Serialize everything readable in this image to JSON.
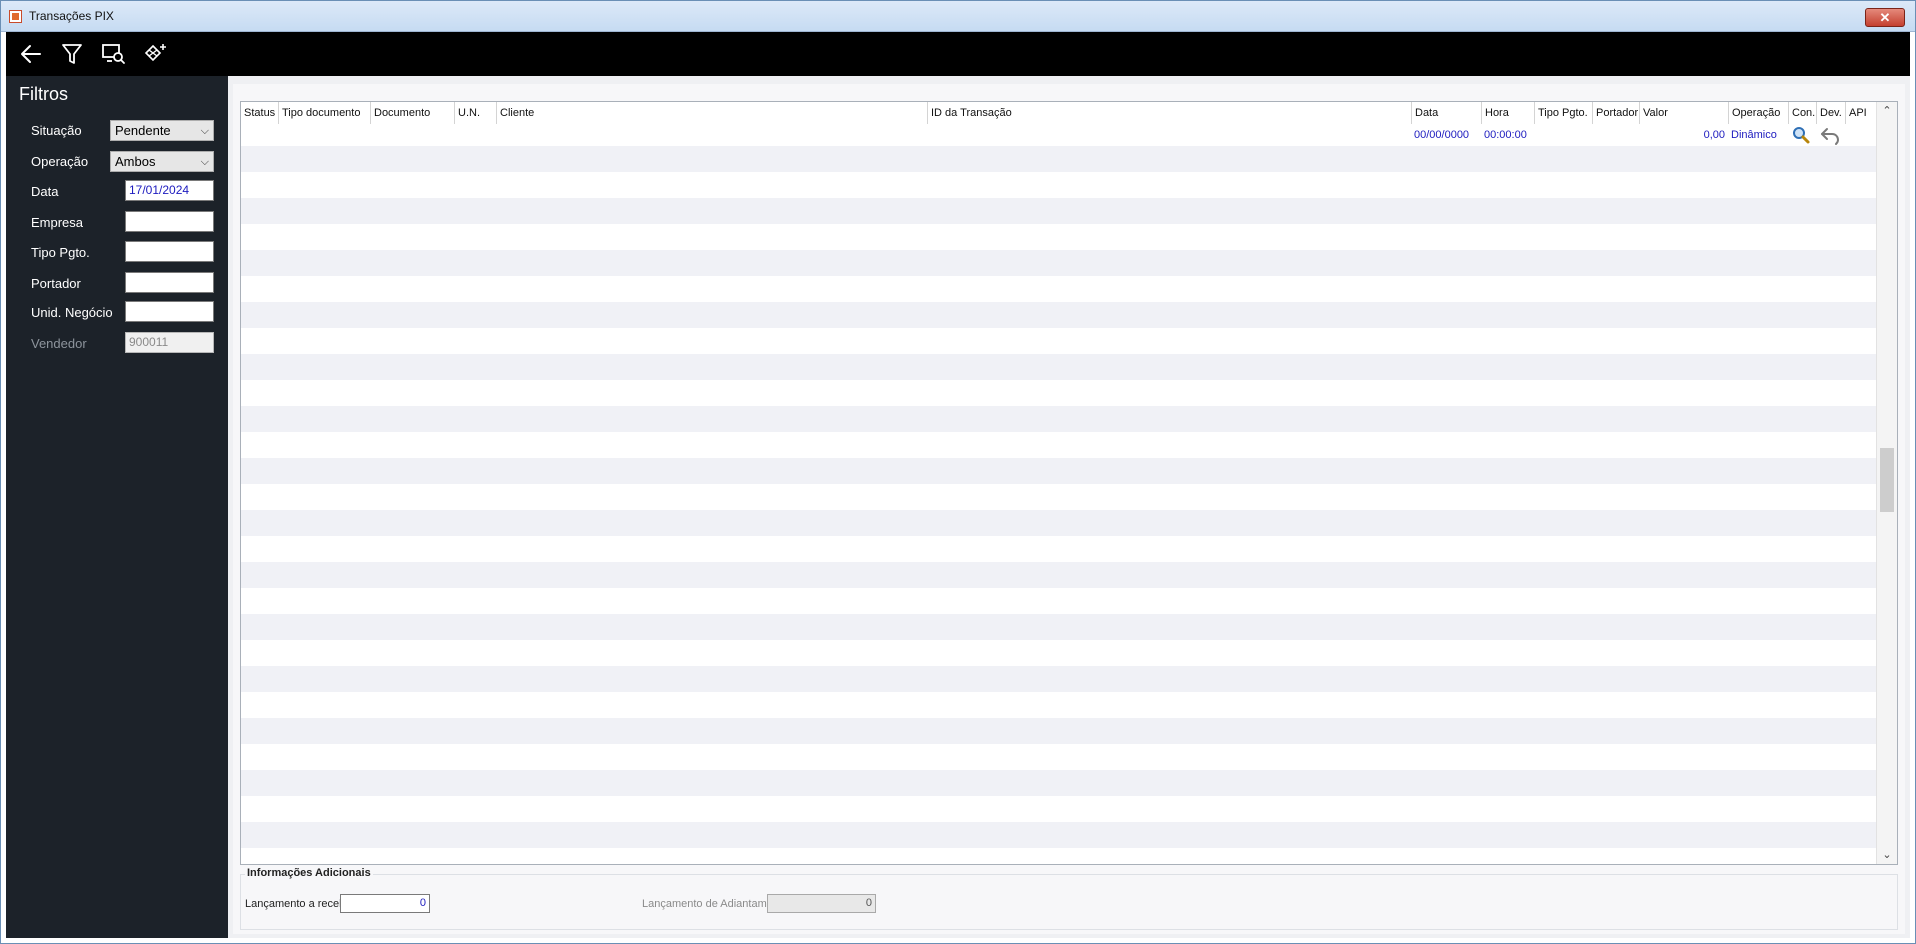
{
  "window": {
    "title": "Transações PIX",
    "close_label": "✕"
  },
  "toolbar": {
    "buttons": [
      {
        "name": "back-arrow-icon",
        "tooltip": ""
      },
      {
        "name": "filter-icon",
        "tooltip": ""
      },
      {
        "name": "screen-search-icon",
        "tooltip": ""
      },
      {
        "name": "pix-add-icon",
        "tooltip": ""
      }
    ]
  },
  "filters": {
    "title": "Filtros",
    "situacao": {
      "label": "Situação",
      "value": "Pendente"
    },
    "operacao": {
      "label": "Operação",
      "value": "Ambos"
    },
    "data": {
      "label": "Data",
      "value": "17/01/2024"
    },
    "empresa": {
      "label": "Empresa",
      "value": ""
    },
    "tipo_pgto": {
      "label": "Tipo Pgto.",
      "value": ""
    },
    "portador": {
      "label": "Portador",
      "value": ""
    },
    "unid_negocio": {
      "label": "Unid. Negócio",
      "value": ""
    },
    "vendedor": {
      "label": "Vendedor",
      "value": "900011"
    }
  },
  "grid": {
    "columns": [
      "Status",
      "Tipo documento",
      "Documento",
      "U.N.",
      "Cliente",
      "ID da Transação",
      "Data",
      "Hora",
      "Tipo Pgto.",
      "Portador",
      "Valor",
      "Operação",
      "Con.",
      "Dev.",
      "API"
    ],
    "rows": [
      {
        "status": "",
        "tipo_documento": "",
        "documento": "",
        "un": "",
        "cliente": "",
        "id_transacao": "",
        "data": "00/00/0000",
        "hora": "00:00:00",
        "tipo_pgto": "",
        "portador": "",
        "valor": "0,00",
        "operacao": "Dinâmico",
        "con_icon": "magnifier-icon",
        "dev_icon": "undo-icon",
        "api": ""
      }
    ]
  },
  "info": {
    "title": "Informações Adicionais",
    "lancamento_receber": {
      "label": "Lançamento a receber",
      "value": "0"
    },
    "lancamento_adiantamento": {
      "label": "Lançamento de Adiantamento",
      "value": "0"
    }
  }
}
